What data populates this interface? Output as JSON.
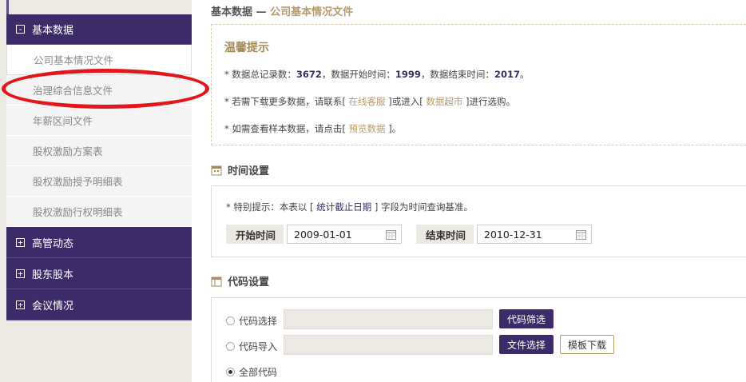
{
  "breadcrumb": {
    "root": "基本数据",
    "sep": " — ",
    "current": "公司基本情况文件"
  },
  "sidebar": {
    "sections": [
      {
        "icon": "minus-icon",
        "label": "基本数据",
        "items": [
          "公司基本情况文件",
          "治理综合信息文件",
          "年薪区间文件",
          "股权激励方案表",
          "股权激励授予明细表",
          "股权激励行权明细表"
        ]
      },
      {
        "icon": "plus-icon",
        "label": "高管动态"
      },
      {
        "icon": "plus-icon",
        "label": "股东股本"
      },
      {
        "icon": "plus-icon",
        "label": "会议情况"
      }
    ],
    "minus": "-",
    "plus": "+"
  },
  "tip": {
    "title": "温馨提示",
    "line1_a": "* 数据总记录数：",
    "records": "3672",
    "line1_b": "，数据开始时间：",
    "start_year": "1999",
    "line1_c": "，数据结束时间：",
    "end_year": "2017",
    "line1_d": "。",
    "line2_a": "* 若需下载更多数据，请联系[",
    "line2_link1": " 在线客服 ",
    "line2_b": "]或进入[",
    "line2_link2": " 数据超市 ",
    "line2_c": "]进行选购。",
    "line3_a": "* 如需查看样本数据，请点击[",
    "line3_link": " 预览数据 ",
    "line3_b": "]。"
  },
  "time_settings": {
    "title": "时间设置",
    "note_a": "* 特别提示：本表以 [ ",
    "note_link": "统计截止日期",
    "note_b": " ] 字段为时间查询基准。",
    "start_label": "开始时间",
    "start_value": "2009-01-01",
    "end_label": "结束时间",
    "end_value": "2010-12-31"
  },
  "code_settings": {
    "title": "代码设置",
    "opt_select": "代码选择",
    "opt_import": "代码导入",
    "opt_all": "全部代码",
    "filter_btn": "代码筛选",
    "file_btn": "文件选择",
    "template_btn": "模板下载"
  }
}
